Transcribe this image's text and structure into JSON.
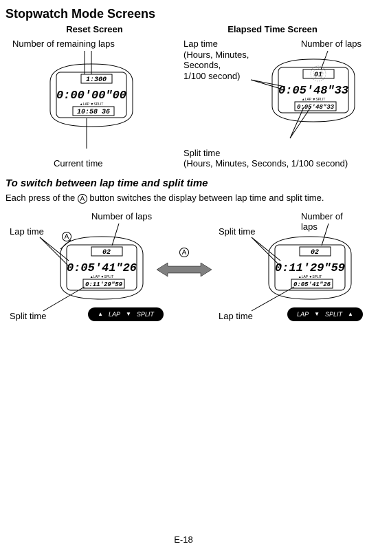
{
  "title": "Stopwatch Mode Screens",
  "resetHeader": "Reset Screen",
  "elapsedHeader": "Elapsed Time Screen",
  "labels": {
    "remainingLaps": "Number of remaining laps",
    "currentTime": "Current time",
    "lapTimeDesc": "Lap time\n(Hours, Minutes,\nSeconds,\n1/100 second)",
    "numberOfLaps": "Number of laps",
    "splitTimeDesc": "Split time\n(Hours, Minutes, Seconds, 1/100 second)",
    "lapTime": "Lap time",
    "splitTime": "Split time"
  },
  "watchReset": {
    "top": "1:300",
    "main": "0:00'00\"00",
    "lapSplit": "▲LAP  ▼SPLIT",
    "bottom": "10:58 36"
  },
  "watchElapsed": {
    "top": "01",
    "main": "0:05'48\"33",
    "lapSplit": "▲LAP  ▼SPLIT",
    "bottom": "0:05'48\"33"
  },
  "watchLapLeft": {
    "top": "02",
    "main": "0:05'41\"26",
    "lapSplit": "▲LAP  ▼SPLIT",
    "bottom": "0:11'29\"59"
  },
  "watchLapRight": {
    "top": "02",
    "main": "0:11'29\"59",
    "lapSplit": "▲LAP  ▼SPLIT",
    "bottom": "0:05'41\"26"
  },
  "subhead": "To switch between lap time and split time",
  "paraPre": "Each press of the ",
  "paraA": "A",
  "paraPost": " button switches the display between lap time and split time.",
  "pillLeft": {
    "lap": "LAP",
    "split": "SPLIT"
  },
  "pillRight": {
    "lap": "LAP",
    "split": "SPLIT"
  },
  "pageNum": "E-18"
}
